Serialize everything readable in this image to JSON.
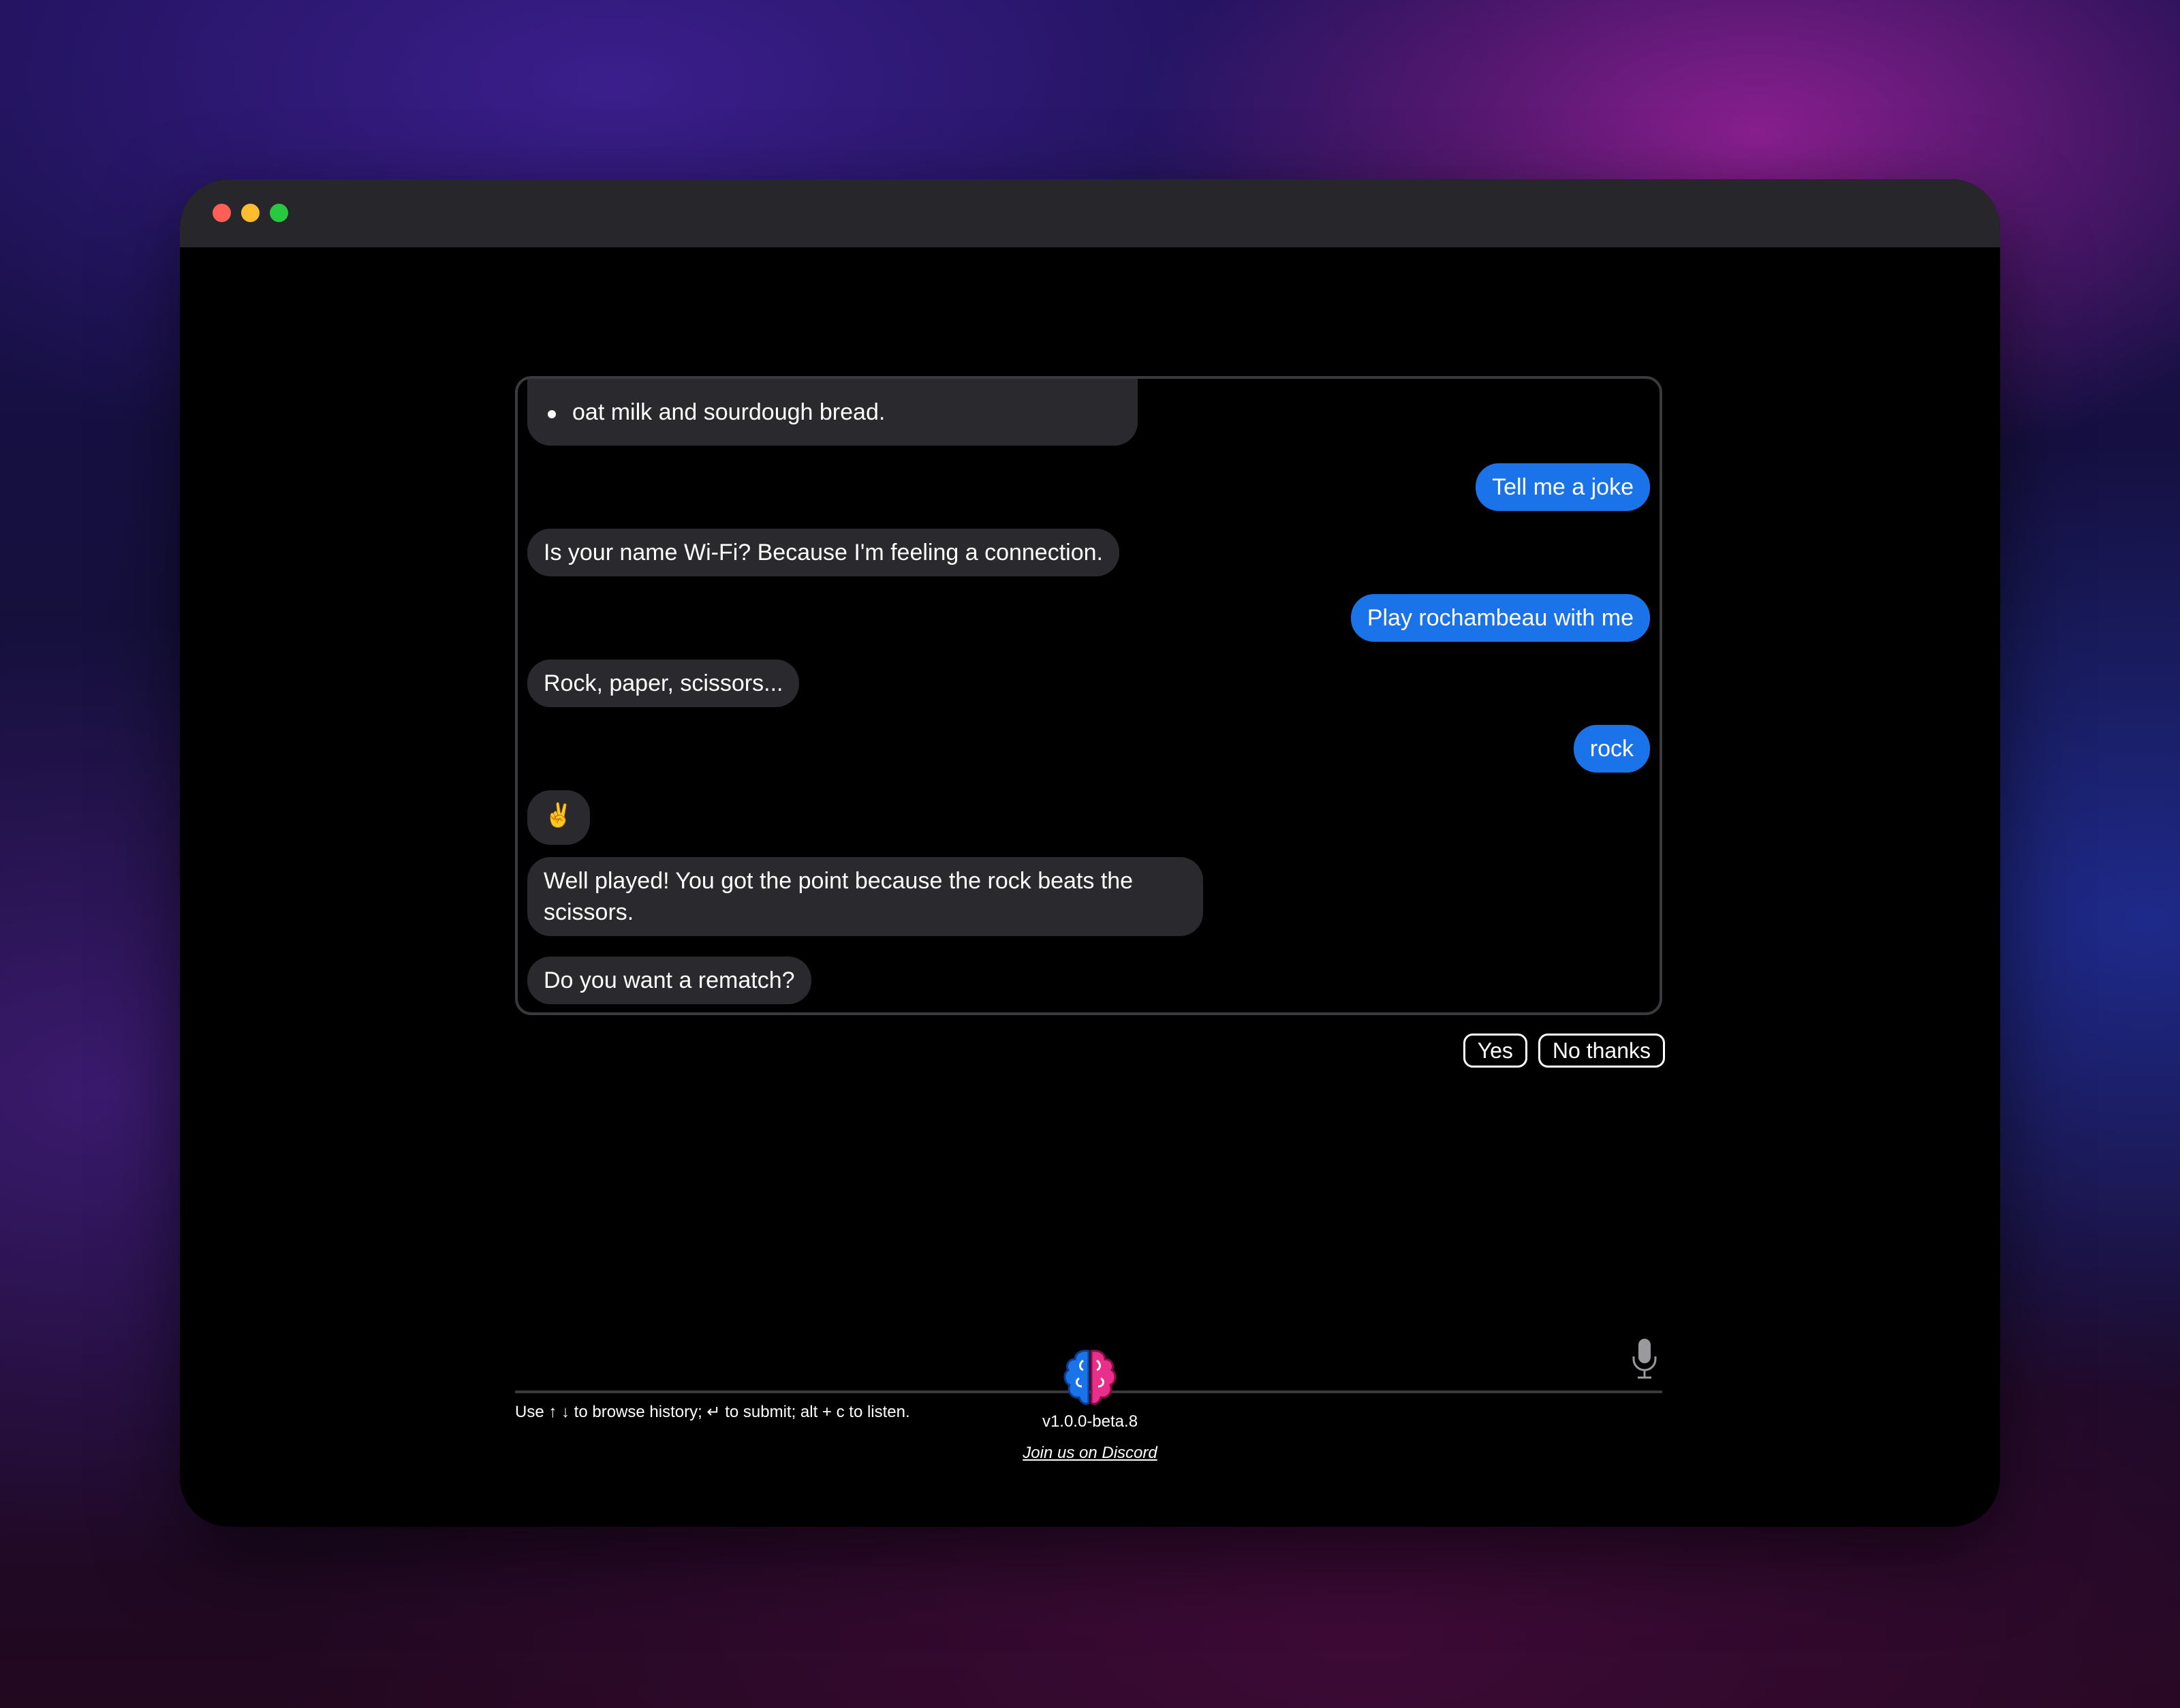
{
  "window": {
    "controls": [
      "close",
      "minimize",
      "maximize"
    ]
  },
  "chat": {
    "messages": [
      {
        "role": "bot",
        "text": "oat milk and sourdough bread."
      },
      {
        "role": "user",
        "text": "Tell me a joke"
      },
      {
        "role": "bot",
        "text": "Is your name Wi-Fi? Because I'm feeling a connection."
      },
      {
        "role": "user",
        "text": "Play rochambeau with me"
      },
      {
        "role": "bot",
        "text": "Rock, paper, scissors..."
      },
      {
        "role": "user",
        "text": "rock"
      },
      {
        "role": "bot",
        "text": "✌️"
      },
      {
        "role": "bot",
        "text": "Well played! You got the point because the rock beats the scissors."
      },
      {
        "role": "bot",
        "text": "Do you want a rematch?"
      }
    ],
    "quick_replies": [
      "Yes",
      "No thanks"
    ]
  },
  "input": {
    "hint": "Use ↑ ↓ to browse history; ↵ to submit; alt + c to listen.",
    "mic_icon": "microphone-icon"
  },
  "footer": {
    "logo_icon": "brain-icon",
    "version": "v1.0.0-beta.8",
    "discord_link": "Join us on Discord"
  },
  "colors": {
    "user_bubble": "#1a73e8",
    "bot_bubble": "#2a2a2e",
    "background": "#000000"
  }
}
